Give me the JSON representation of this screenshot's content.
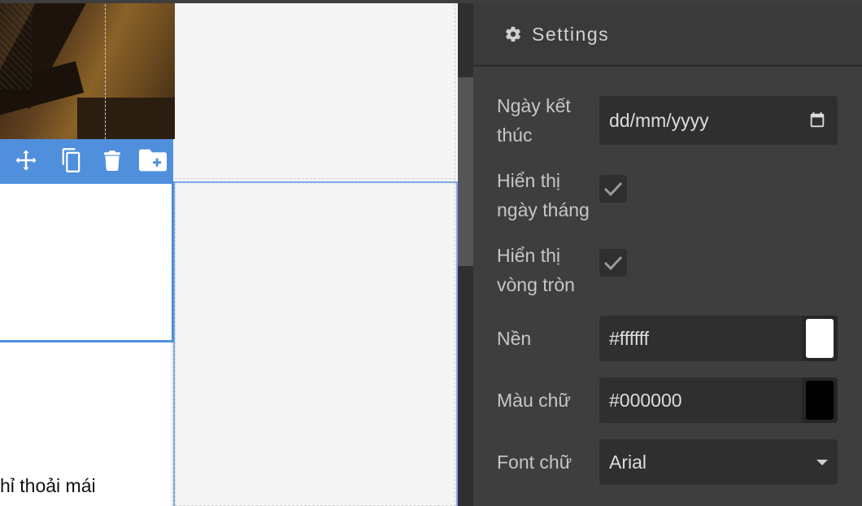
{
  "canvas": {
    "body_text": "hỉ thoải mái"
  },
  "toolbar": {
    "buttons": [
      {
        "name": "move-icon"
      },
      {
        "name": "copy-icon"
      },
      {
        "name": "trash-icon"
      },
      {
        "name": "folder-plus-icon"
      }
    ]
  },
  "settings": {
    "title": "Settings",
    "icon": "gear-icon",
    "end_date": {
      "label_line1": "Ngày kết",
      "label_line2": "thúc",
      "placeholder": "dd/mm/yyyy",
      "icon": "calendar-icon"
    },
    "show_date": {
      "label_line1": "Hiển thị",
      "label_line2": "ngày tháng",
      "checked": true
    },
    "show_circle": {
      "label_line1": "Hiển thị",
      "label_line2": "vòng tròn",
      "checked": true
    },
    "background": {
      "label": "Nền",
      "value": "#ffffff",
      "swatch": "#ffffff"
    },
    "text_color": {
      "label": "Màu chữ",
      "value": "#000000",
      "swatch": "#000000"
    },
    "font": {
      "label": "Font chữ",
      "value": "Arial"
    }
  },
  "colors": {
    "accent": "#4f8fdc",
    "panel_bg": "#3e3e3e",
    "field_bg": "#2f2f2f"
  }
}
